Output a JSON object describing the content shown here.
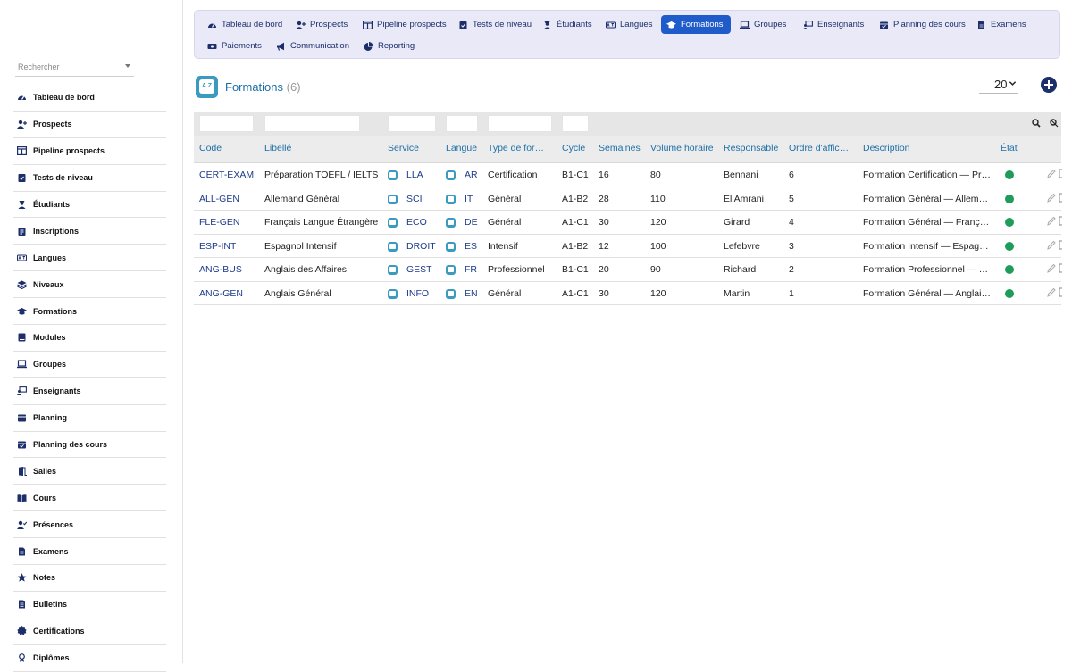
{
  "sidebar": {
    "search_placeholder": "Rechercher",
    "items": [
      {
        "label": "Tableau de bord",
        "icon": "dashboard-icon"
      },
      {
        "label": "Prospects",
        "icon": "user-plus-icon"
      },
      {
        "label": "Pipeline prospects",
        "icon": "columns-icon"
      },
      {
        "label": "Tests de niveau",
        "icon": "clipboard-check-icon"
      },
      {
        "label": "Étudiants",
        "icon": "student-icon"
      },
      {
        "label": "Inscriptions",
        "icon": "clipboard-icon"
      },
      {
        "label": "Langues",
        "icon": "language-icon"
      },
      {
        "label": "Niveaux",
        "icon": "layers-icon"
      },
      {
        "label": "Formations",
        "icon": "graduation-cap-icon"
      },
      {
        "label": "Modules",
        "icon": "book-icon"
      },
      {
        "label": "Groupes",
        "icon": "laptop-icon"
      },
      {
        "label": "Enseignants",
        "icon": "teacher-icon"
      },
      {
        "label": "Planning",
        "icon": "calendar-icon"
      },
      {
        "label": "Planning des cours",
        "icon": "calendar-check-icon"
      },
      {
        "label": "Salles",
        "icon": "door-icon"
      },
      {
        "label": "Cours",
        "icon": "open-book-icon"
      },
      {
        "label": "Présences",
        "icon": "user-check-icon"
      },
      {
        "label": "Examens",
        "icon": "file-icon"
      },
      {
        "label": "Notes",
        "icon": "star-icon"
      },
      {
        "label": "Bulletins",
        "icon": "file-lines-icon"
      },
      {
        "label": "Certifications",
        "icon": "certificate-icon"
      },
      {
        "label": "Diplômes",
        "icon": "award-icon"
      }
    ]
  },
  "topnav": {
    "items": [
      {
        "label": "Tableau de bord",
        "icon": "dashboard-icon"
      },
      {
        "label": "Prospects",
        "icon": "user-plus-icon"
      },
      {
        "label": "Pipeline prospects",
        "icon": "columns-icon"
      },
      {
        "label": "Tests de niveau",
        "icon": "clipboard-check-icon"
      },
      {
        "label": "Étudiants",
        "icon": "student-icon"
      },
      {
        "label": "Langues",
        "icon": "language-icon"
      },
      {
        "label": "Formations",
        "icon": "graduation-cap-icon",
        "active": true
      },
      {
        "label": "Groupes",
        "icon": "laptop-icon"
      },
      {
        "label": "Enseignants",
        "icon": "teacher-icon"
      },
      {
        "label": "Planning des cours",
        "icon": "calendar-check-icon"
      },
      {
        "label": "Examens",
        "icon": "file-icon"
      },
      {
        "label": "Paiements",
        "icon": "money-icon"
      },
      {
        "label": "Communication",
        "icon": "megaphone-icon"
      },
      {
        "label": "Reporting",
        "icon": "pie-chart-icon"
      }
    ]
  },
  "header": {
    "title": "Formations",
    "count": "(6)",
    "page_size": "20"
  },
  "table": {
    "columns": [
      "Code",
      "Libellé",
      "Service",
      "Langue",
      "Type de for…",
      "Cycle",
      "Semaines",
      "Volume horaire",
      "Responsable",
      "Ordre d'affic…",
      "Description",
      "État"
    ],
    "rows": [
      {
        "code": "CERT-EXAM",
        "libelle": "Préparation TOEFL / IELTS",
        "service": "LLA",
        "langue": "AR",
        "type": "Certification",
        "cycle": "B1-C1",
        "semaines": "16",
        "volume": "80",
        "responsable": "Bennani",
        "ordre": "6",
        "description": "Formation Certification — Préparation TOEFL / IELTS",
        "etat": "active"
      },
      {
        "code": "ALL-GEN",
        "libelle": "Allemand Général",
        "service": "SCI",
        "langue": "IT",
        "type": "Général",
        "cycle": "A1-B2",
        "semaines": "28",
        "volume": "110",
        "responsable": "El Amrani",
        "ordre": "5",
        "description": "Formation Général — Allemand Général",
        "etat": "active"
      },
      {
        "code": "FLE-GEN",
        "libelle": "Français Langue Étrangère",
        "service": "ECO",
        "langue": "DE",
        "type": "Général",
        "cycle": "A1-C1",
        "semaines": "30",
        "volume": "120",
        "responsable": "Girard",
        "ordre": "4",
        "description": "Formation Général — Français Langue Étrangère",
        "etat": "active"
      },
      {
        "code": "ESP-INT",
        "libelle": "Espagnol Intensif",
        "service": "DROIT",
        "langue": "ES",
        "type": "Intensif",
        "cycle": "A1-B2",
        "semaines": "12",
        "volume": "100",
        "responsable": "Lefebvre",
        "ordre": "3",
        "description": "Formation Intensif — Espagnol Intensif",
        "etat": "active"
      },
      {
        "code": "ANG-BUS",
        "libelle": "Anglais des Affaires",
        "service": "GEST",
        "langue": "FR",
        "type": "Professionnel",
        "cycle": "B1-C1",
        "semaines": "20",
        "volume": "90",
        "responsable": "Richard",
        "ordre": "2",
        "description": "Formation Professionnel — Anglais des Affaires",
        "etat": "active"
      },
      {
        "code": "ANG-GEN",
        "libelle": "Anglais Général",
        "service": "INFO",
        "langue": "EN",
        "type": "Général",
        "cycle": "A1-C1",
        "semaines": "30",
        "volume": "120",
        "responsable": "Martin",
        "ordre": "1",
        "description": "Formation Général — Anglais Général",
        "etat": "active"
      }
    ]
  },
  "colors": {
    "accent": "#1f5bc9",
    "nav_bg": "#e9e9f8",
    "link": "#1c6fa6",
    "status_active": "#1f9b5a"
  }
}
